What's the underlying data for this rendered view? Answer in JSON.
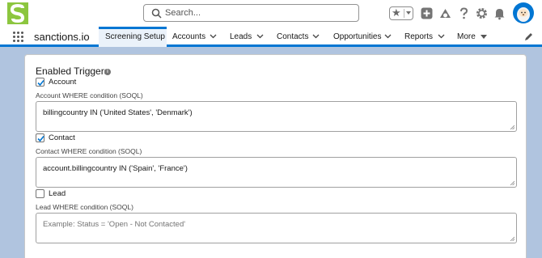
{
  "header": {
    "logo_icon": "sanctions-s-logo-icon",
    "search_placeholder": "Search...",
    "icons": [
      "favorites-star-icon",
      "add-plus-icon",
      "trailhead-icon",
      "help-icon",
      "settings-gear-icon",
      "notifications-bell-icon",
      "user-avatar"
    ],
    "brand_color": "#0176d3",
    "logo_color": "#8cc63f"
  },
  "nav": {
    "app_name": "sanctions.io",
    "active_tab": "Screening Setup",
    "tabs": [
      "Accounts",
      "Leads",
      "Contacts",
      "Opportunities",
      "Reports",
      "More"
    ]
  },
  "main": {
    "section_title": "Enabled Triggers",
    "triggers": [
      {
        "label": "Account",
        "checked": true,
        "condition_label": "Account WHERE condition (SOQL)",
        "value": "billingcountry IN ('United States', 'Denmark')"
      },
      {
        "label": "Contact",
        "checked": true,
        "condition_label": "Contact WHERE condition (SOQL)",
        "value": "account.billingcountry IN ('Spain', 'France')"
      },
      {
        "label": "Lead",
        "checked": false,
        "condition_label": "Lead WHERE condition (SOQL)",
        "placeholder": "Example: Status = 'Open - Not Contacted'"
      }
    ]
  }
}
